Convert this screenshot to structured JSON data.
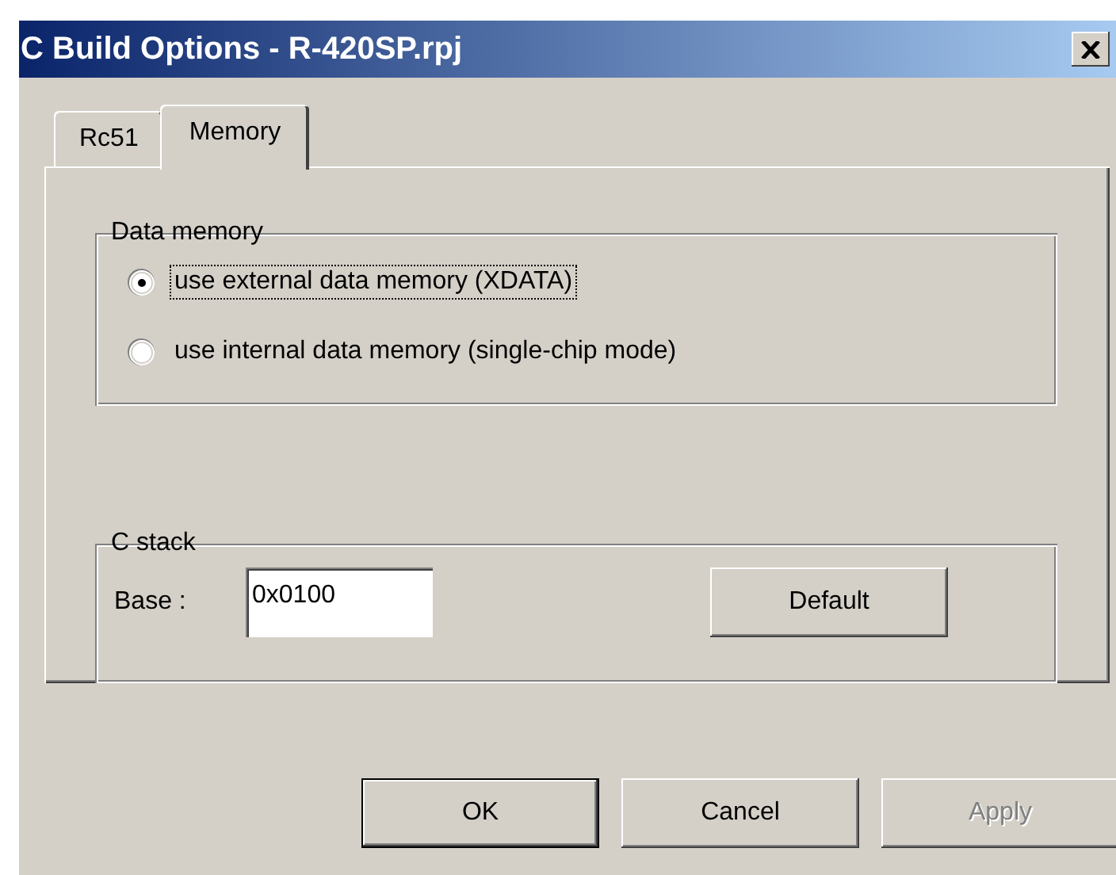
{
  "window": {
    "title": "C Build Options - R-420SP.rpj"
  },
  "tabs": [
    {
      "label": "Rc51",
      "selected": false
    },
    {
      "label": "Memory",
      "selected": true
    }
  ],
  "data_memory": {
    "title": "Data memory",
    "options": [
      {
        "label": "use external data memory (XDATA)",
        "selected": true,
        "focused": true
      },
      {
        "label": "use internal data memory (single-chip mode)",
        "selected": false,
        "focused": false
      }
    ]
  },
  "c_stack": {
    "title": "C stack",
    "base_label": "Base :",
    "base_value": "0x0100",
    "default_button": "Default"
  },
  "buttons": [
    {
      "label": "OK",
      "default": true,
      "disabled": false
    },
    {
      "label": "Cancel",
      "default": false,
      "disabled": false
    },
    {
      "label": "Apply",
      "default": false,
      "disabled": true
    }
  ]
}
